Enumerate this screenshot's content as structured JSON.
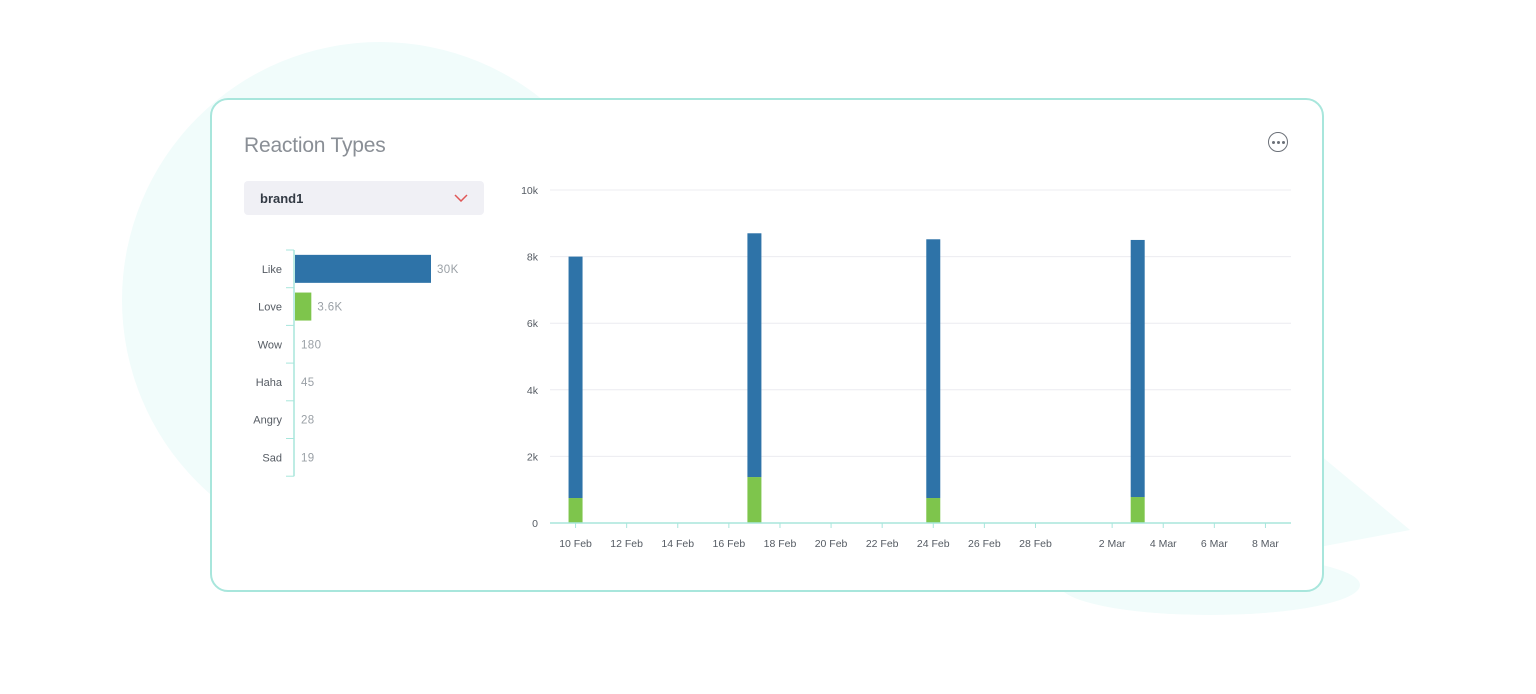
{
  "card": {
    "title": "Reaction Types",
    "brand_select": {
      "selected": "brand1"
    }
  },
  "colors": {
    "like": "#2e73a8",
    "love": "#7ec54c",
    "accent_border": "#a8e6dc",
    "dropdown_chevron": "#e05757",
    "background_blob": "#f1fcfb"
  },
  "icons": {
    "more": "more-icon",
    "dropdown": "chevron-down-icon"
  },
  "chart_data": [
    {
      "type": "bar",
      "orientation": "horizontal",
      "categories": [
        "Like",
        "Love",
        "Wow",
        "Haha",
        "Angry",
        "Sad"
      ],
      "values": [
        30000,
        3600,
        180,
        45,
        28,
        19
      ],
      "value_labels": [
        "30K",
        "3.6K",
        "180",
        "45",
        "28",
        "19"
      ],
      "bar_colors": [
        "#2e73a8",
        "#7ec54c",
        "#2e73a8",
        "#2e73a8",
        "#2e73a8",
        "#2e73a8"
      ]
    },
    {
      "type": "bar",
      "stacked": true,
      "x_ticks": [
        "10 Feb",
        "12 Feb",
        "14 Feb",
        "16 Feb",
        "18 Feb",
        "20 Feb",
        "22 Feb",
        "24 Feb",
        "26 Feb",
        "28 Feb",
        "2 Mar",
        "4 Mar",
        "6 Mar",
        "8 Mar"
      ],
      "x_range": [
        "9 Feb",
        "9 Mar"
      ],
      "y_ticks": [
        "0",
        "2k",
        "4k",
        "6k",
        "8k",
        "10k"
      ],
      "ylim": [
        0,
        10000
      ],
      "grid": true,
      "x": [
        "10 Feb",
        "17 Feb",
        "24 Feb",
        "3 Mar"
      ],
      "series": [
        {
          "color": "#7ec54c",
          "values": [
            750,
            1380,
            750,
            780
          ]
        },
        {
          "color": "#2e73a8",
          "values": [
            7250,
            7320,
            7770,
            7720
          ]
        }
      ]
    }
  ]
}
